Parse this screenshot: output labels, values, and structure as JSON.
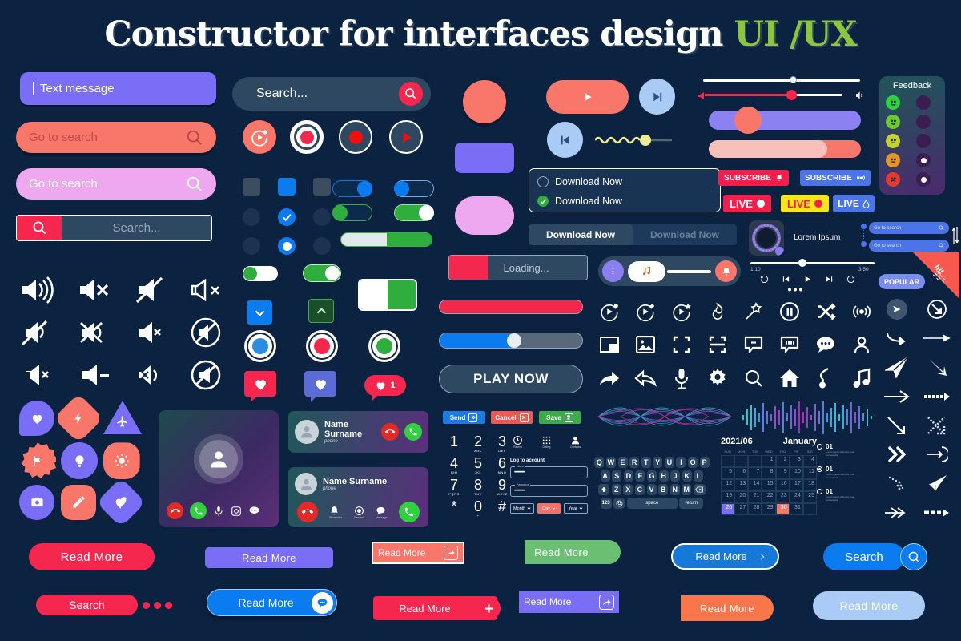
{
  "header": {
    "title_white": "Constructor for interfaces design",
    "title_green": "UI /UX"
  },
  "colors": {
    "bg": "#0b2240",
    "purple": "#7b6ef6",
    "coral": "#f9766b",
    "pink_light": "#eda8f0",
    "red": "#f5274e",
    "blue": "#0a7cf0",
    "green": "#3aad4a",
    "slate": "#2f4861",
    "lime": "#8cc63f",
    "orange": "#f9764a",
    "babyblue": "#a9cbf5"
  },
  "inputs": {
    "text_message": "Text message",
    "go_to_search_1": "Go to search",
    "go_to_search_2": "Go to search",
    "search_dots": "Search...",
    "search_rounded": "Search..."
  },
  "download": {
    "radio_1": "Download Now",
    "radio_2": "Download Now",
    "tab_active": "Download Now",
    "tab_inactive": "Download Now"
  },
  "progress": {
    "loading_label": "Loading...",
    "play_now": "PLAY NOW"
  },
  "subscribe": {
    "red": "SUBSCRIBE",
    "blue": "SUBSCRIBE"
  },
  "live": {
    "red": "LIVE",
    "yellow": "LIVE",
    "blue": "LIVE"
  },
  "feedback": {
    "title": "Feedback"
  },
  "player": {
    "track_title": "Lorem Ipsum",
    "time_current": "1:10",
    "time_total": "3:50",
    "popular_badge": "POPULAR",
    "hit_badge": "hit"
  },
  "mini_search": {
    "one": "Go to search",
    "two": "Go to search"
  },
  "contact": {
    "name": "Name Surname",
    "sub": "phone",
    "actions": [
      "Reminder",
      "Record",
      "Message"
    ]
  },
  "form": {
    "send": "Send",
    "cancel": "Cancel",
    "save": "Save",
    "login_title": "Log to account",
    "name_label": "Name",
    "name_value": "••••••••••••",
    "password_label": "Password",
    "password_value": "••••••••••••",
    "selects": [
      "Month",
      "Day",
      "Year"
    ],
    "phone_tabs": [
      "Recent",
      "Dialing",
      "Contacts"
    ],
    "keys": [
      {
        "d": "1",
        "s": ""
      },
      {
        "d": "2",
        "s": "ABC"
      },
      {
        "d": "3",
        "s": "DEF"
      },
      {
        "d": "4",
        "s": "GHI"
      },
      {
        "d": "5",
        "s": "JKL"
      },
      {
        "d": "6",
        "s": "MNO"
      },
      {
        "d": "7",
        "s": "PQRS"
      },
      {
        "d": "8",
        "s": "TUV"
      },
      {
        "d": "9",
        "s": "WXYZ"
      },
      {
        "d": "*",
        "s": ""
      },
      {
        "d": "0",
        "s": "+"
      },
      {
        "d": "#",
        "s": ""
      }
    ]
  },
  "keyboard": {
    "row1": [
      "Q",
      "W",
      "E",
      "R",
      "T",
      "Y",
      "U",
      "I",
      "O",
      "P"
    ],
    "row2": [
      "A",
      "S",
      "D",
      "F",
      "G",
      "H",
      "J",
      "K",
      "L"
    ],
    "row3": [
      "Z",
      "X",
      "C",
      "V",
      "B",
      "N",
      "M"
    ],
    "space": "space",
    "return": "return",
    "numbers": "123"
  },
  "calendar": {
    "year_month": "2021/06",
    "month_name": "January",
    "weekdays": [
      "SUN",
      "MON",
      "TUE",
      "WED",
      "THU",
      "FRI",
      "SAT"
    ],
    "weeks": [
      [
        "",
        "",
        "",
        "1",
        "2",
        "3",
        "4"
      ],
      [
        "5",
        "6",
        "7",
        "8",
        "9",
        "10",
        "11"
      ],
      [
        "12",
        "13",
        "14",
        "15",
        "16",
        "17",
        "18"
      ],
      [
        "19",
        "20",
        "21",
        "22",
        "23",
        "24",
        "25"
      ],
      [
        "26",
        "27",
        "28",
        "29",
        "30",
        "31",
        ""
      ]
    ],
    "selected_blue": "26",
    "selected_red": "30"
  },
  "checklist": [
    {
      "num": "01",
      "text": "Lorem ipsum dolor sit amet consectetur"
    },
    {
      "num": "01",
      "text": "Lorem ipsum dolor sit amet consectetur"
    },
    {
      "num": "01",
      "text": "Lorem ipsum dolor sit amet consectetur"
    }
  ],
  "heart_badge_count": "1",
  "buttons": {
    "read_more_red": "Read  More",
    "read_more_purple": "Read  More",
    "read_more_coral": "Read  More",
    "read_more_green": "Read  More",
    "read_more_blue_outline": "Read  More",
    "search_blue": "Search",
    "search_red": "Search",
    "read_more_blue_chat": "Read  More",
    "read_more_red_plus": "Read  More",
    "read_more_purple_share": "Read  More",
    "read_more_orange": "Read  More",
    "read_more_babyblue": "Read  More"
  }
}
